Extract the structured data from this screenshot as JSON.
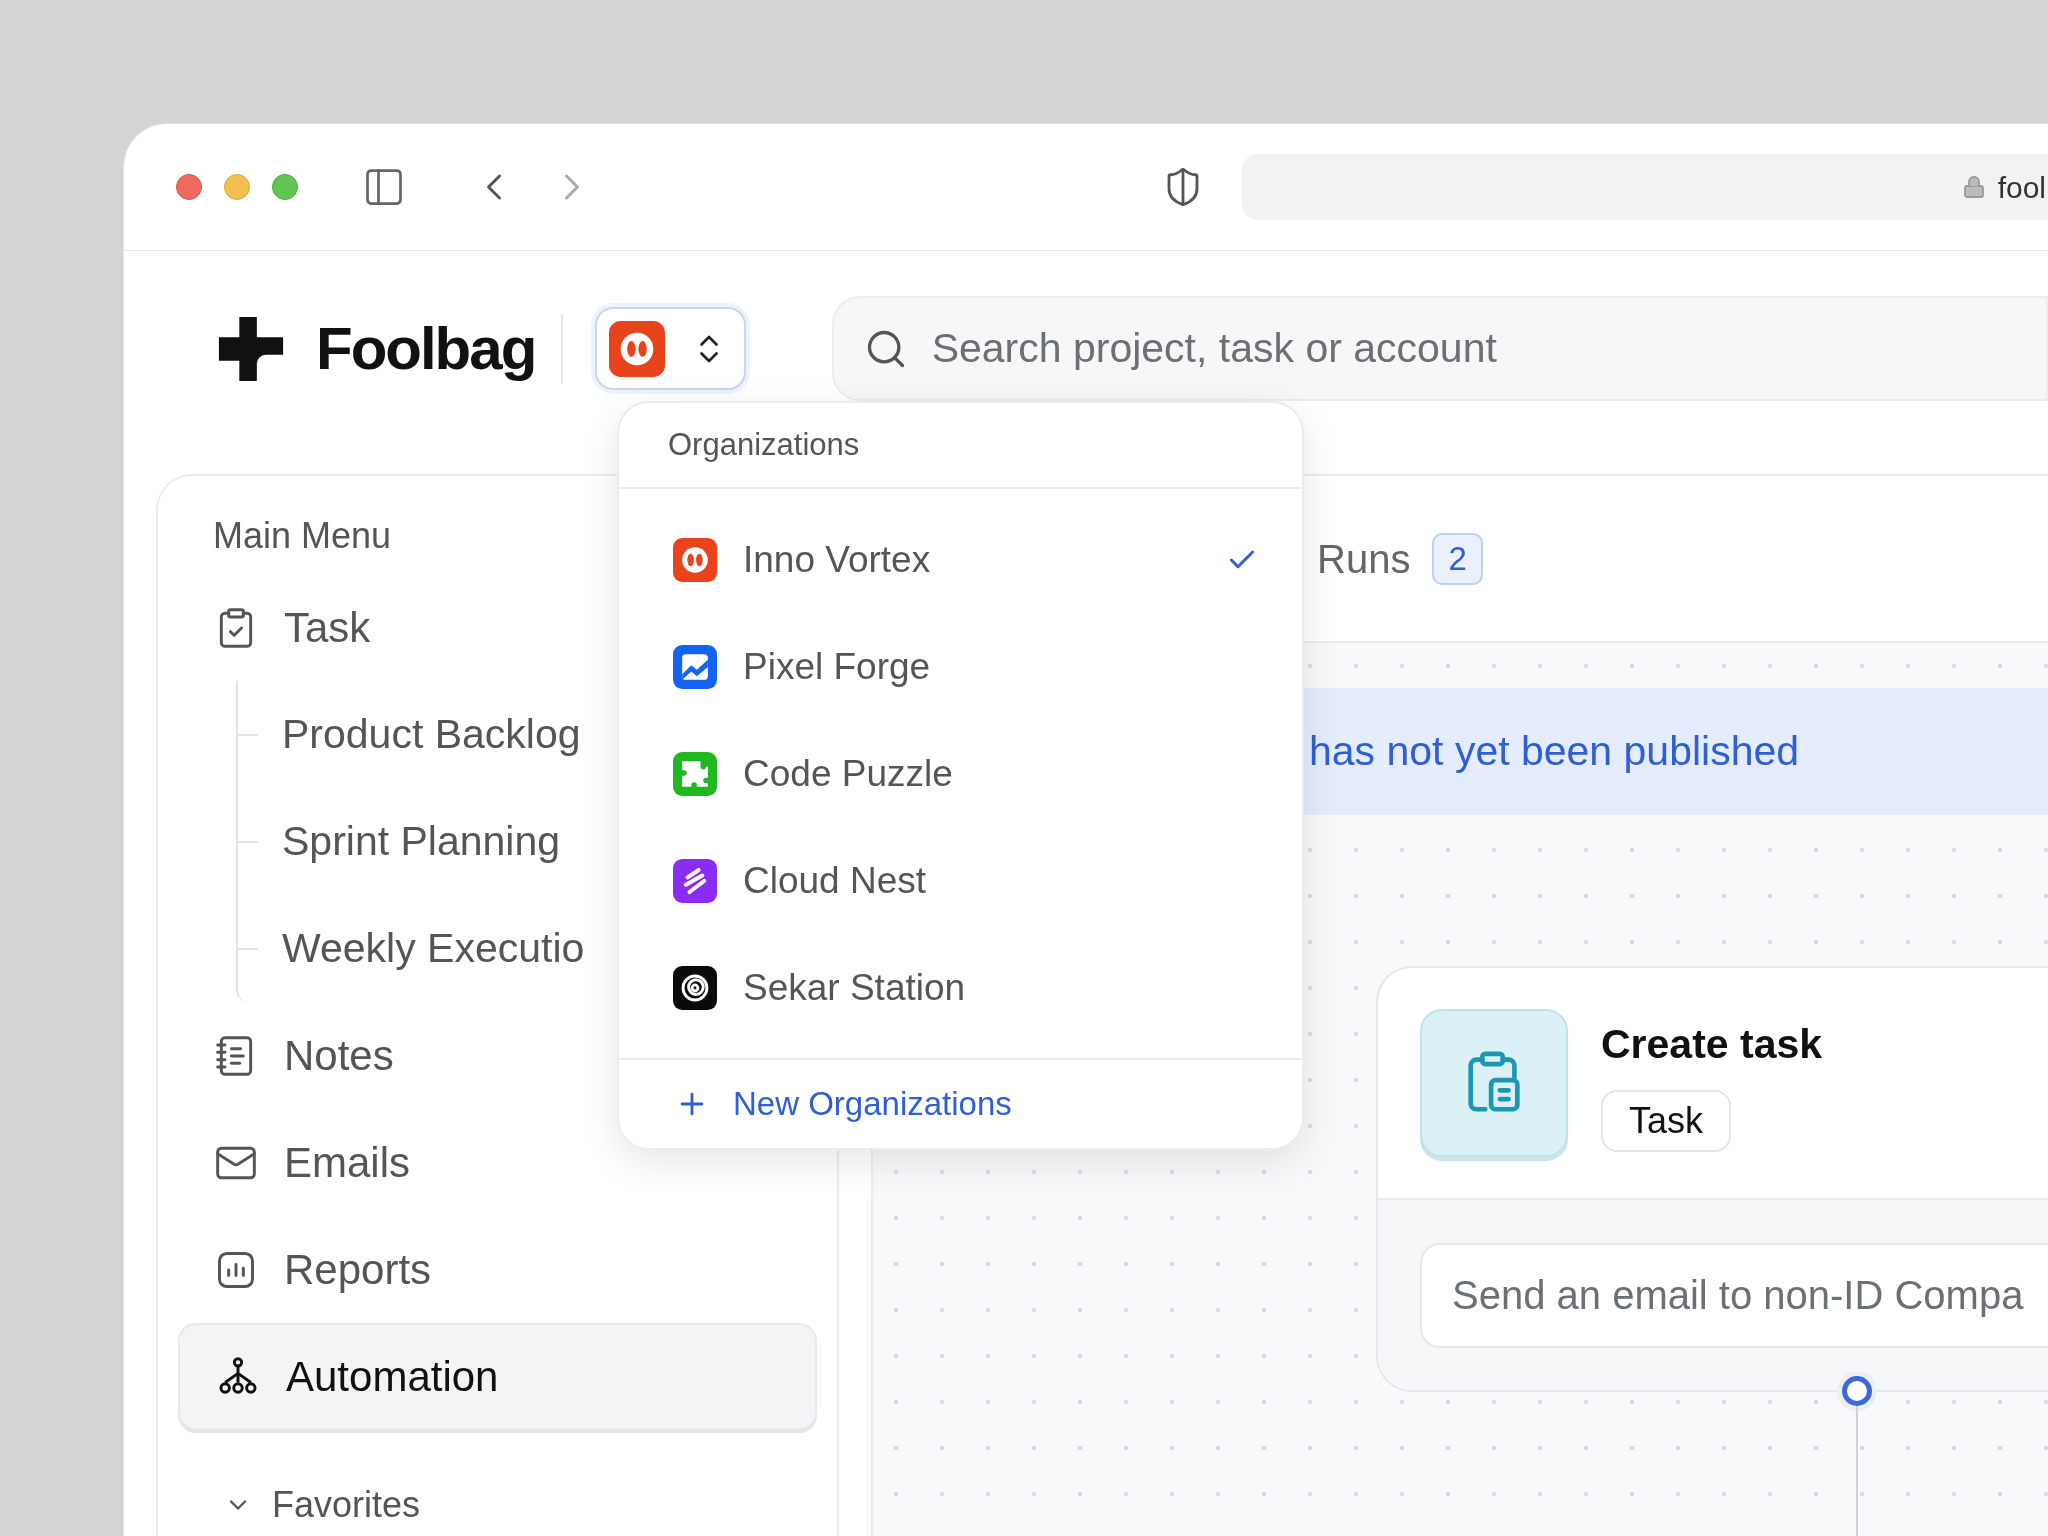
{
  "browser": {
    "url": "fool"
  },
  "brand": {
    "name": "Foolbag"
  },
  "search": {
    "placeholder": "Search project, task or account"
  },
  "sidebar": {
    "heading": "Main Menu",
    "items": [
      {
        "label": "Task",
        "kind": "task",
        "selected": false,
        "children": [
          {
            "label": "Product Backlog"
          },
          {
            "label": "Sprint Planning"
          },
          {
            "label": "Weekly Executio"
          }
        ]
      },
      {
        "label": "Notes",
        "kind": "notes",
        "selected": false
      },
      {
        "label": "Emails",
        "kind": "emails",
        "selected": false
      },
      {
        "label": "Reports",
        "kind": "reports",
        "selected": false
      },
      {
        "label": "Automation",
        "kind": "automation",
        "selected": true
      }
    ],
    "favorites": {
      "label": "Favorites",
      "expanded": true
    }
  },
  "org_menu": {
    "heading": "Organizations",
    "organizations": [
      {
        "name": "Inno Vortex",
        "kind": "rings",
        "color": "#e8431a",
        "selected": true
      },
      {
        "name": "Pixel Forge",
        "kind": "chart",
        "color": "#1463f3",
        "selected": false
      },
      {
        "name": "Code Puzzle",
        "kind": "puzzle",
        "color": "#1fb81f",
        "selected": false
      },
      {
        "name": "Cloud Nest",
        "kind": "waves",
        "color": "#8b2cf5",
        "selected": false
      },
      {
        "name": "Sekar Station",
        "kind": "spiral",
        "color": "#0a0a0a",
        "selected": false
      }
    ],
    "new_label": "New Organizations"
  },
  "tabs": [
    {
      "label": "Runs",
      "badge": "2",
      "selected": false
    }
  ],
  "banner": {
    "text": "has not yet been published"
  },
  "node": {
    "title": "Create task",
    "tag": "Task",
    "value": "Send an email to non-ID Compa"
  }
}
